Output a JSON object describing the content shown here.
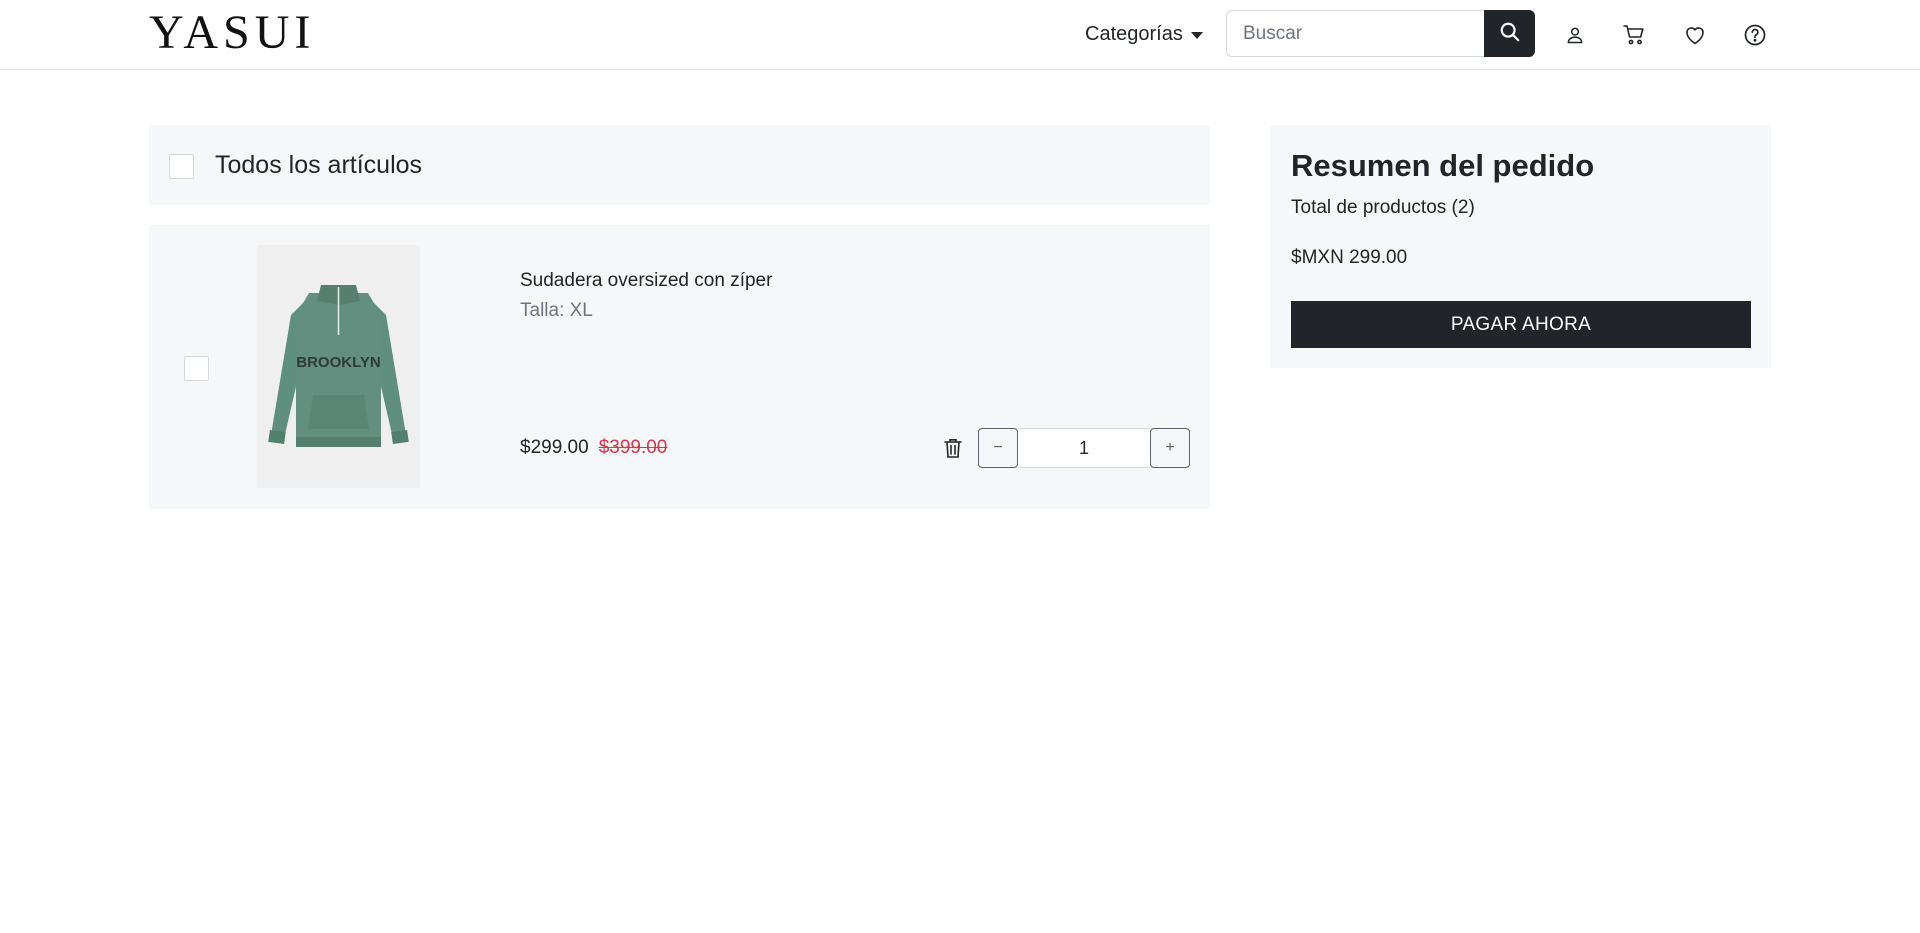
{
  "header": {
    "logo": "YASUI",
    "categories_label": "Categorías",
    "search": {
      "placeholder": "Buscar",
      "value": ""
    },
    "icons": [
      "search-icon",
      "user-icon",
      "cart-icon",
      "heart-icon",
      "help-icon"
    ]
  },
  "cart": {
    "select_all_label": "Todos los artículos",
    "items": [
      {
        "name": "Sudadera oversized con zíper",
        "size": "Talla: XL",
        "price": "$299.00",
        "old_price": "$399.00",
        "quantity": "1",
        "decrement_label": "−",
        "increment_label": "+",
        "image_text": "BROOKLYN"
      }
    ]
  },
  "summary": {
    "title": "Resumen del pedido",
    "count": "Total de productos (2)",
    "total": "$MXN 299.00",
    "pay_label": "PAGAR AHORA"
  },
  "colors": {
    "accent": "#212529",
    "panel_bg": "#f6f7f9",
    "old_price": "#dc3545",
    "sweatshirt": "#5f8f7e"
  }
}
